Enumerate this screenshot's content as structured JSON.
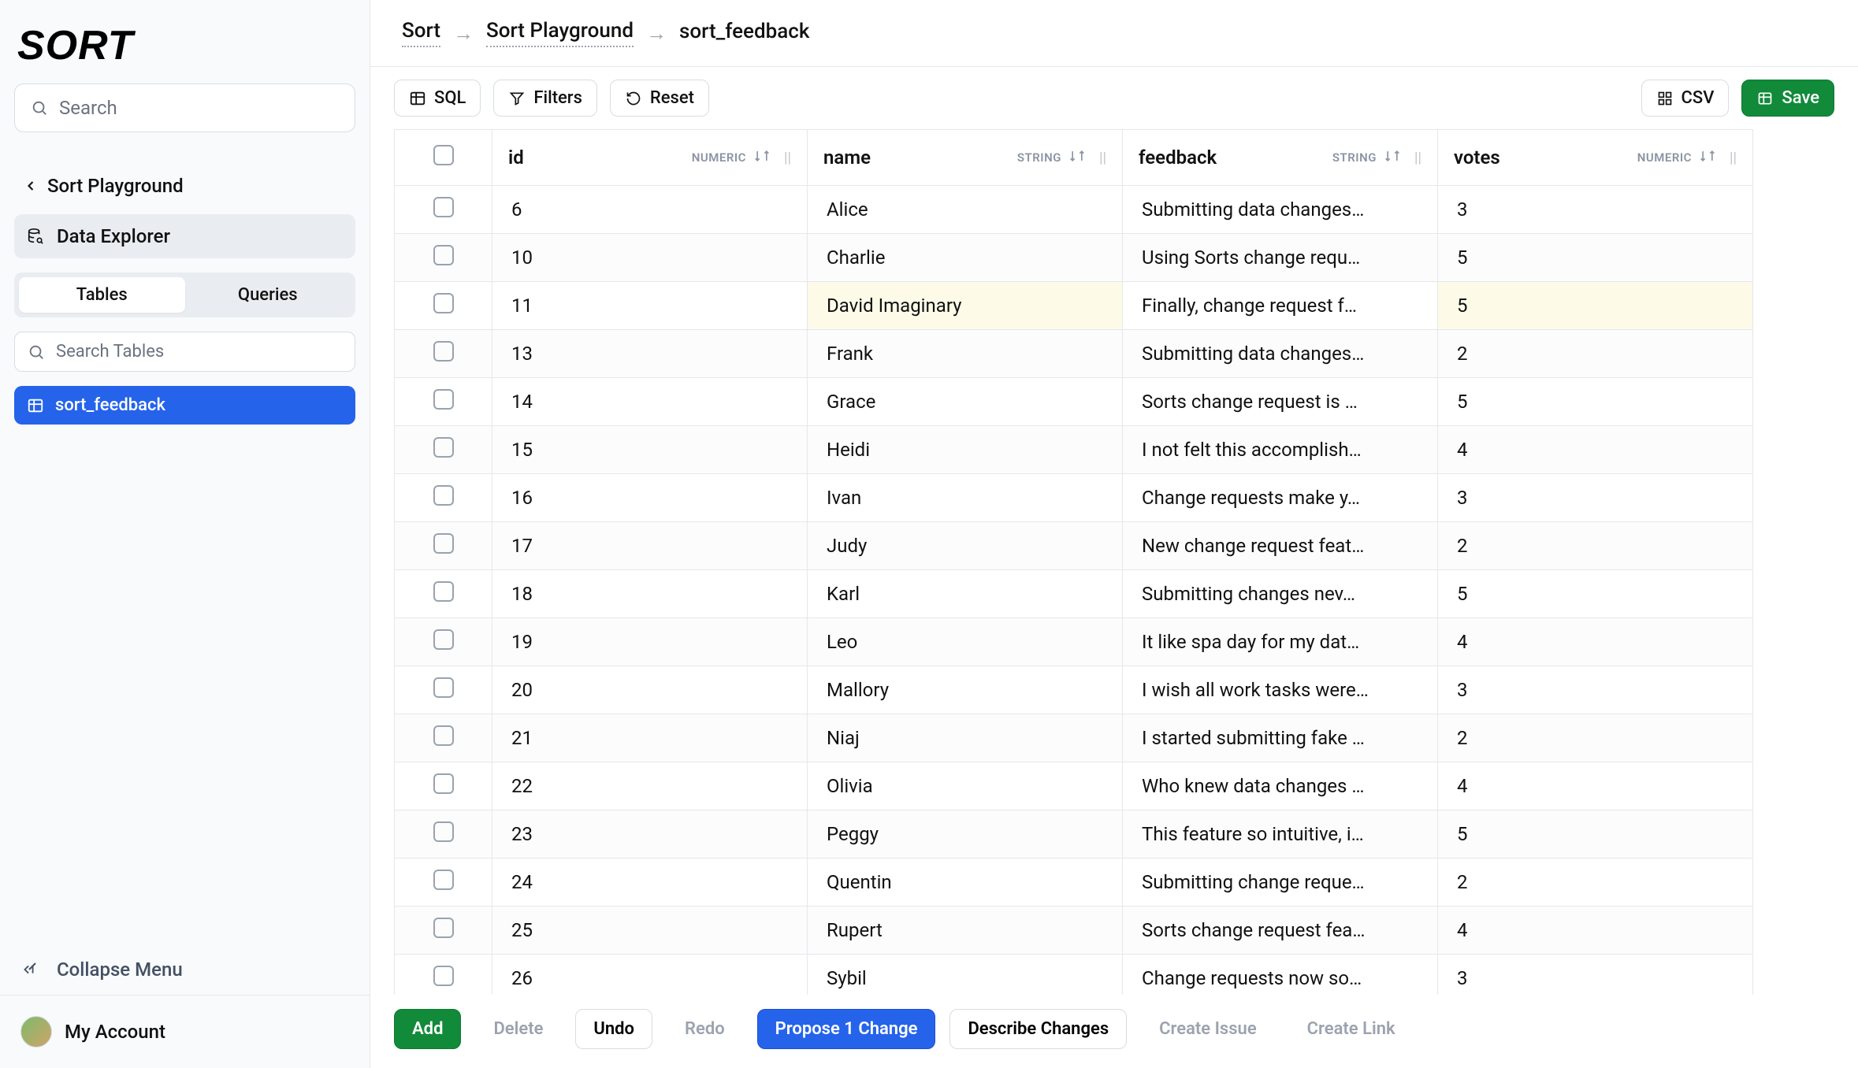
{
  "logo_text": "SORT",
  "sidebar": {
    "search_placeholder": "Search",
    "back_label": "Sort Playground",
    "data_explorer_label": "Data Explorer",
    "tabs": {
      "tables": "Tables",
      "queries": "Queries"
    },
    "search_tables_placeholder": "Search Tables",
    "active_table": "sort_feedback",
    "collapse_label": "Collapse Menu",
    "account_label": "My Account"
  },
  "breadcrumbs": {
    "a": "Sort",
    "b": "Sort Playground",
    "c": "sort_feedback"
  },
  "toolbar": {
    "sql": "SQL",
    "filters": "Filters",
    "reset": "Reset",
    "csv": "CSV",
    "save": "Save"
  },
  "columns": {
    "id": {
      "label": "id",
      "type": "NUMERIC"
    },
    "name": {
      "label": "name",
      "type": "STRING"
    },
    "fb": {
      "label": "feedback",
      "type": "STRING"
    },
    "votes": {
      "label": "votes",
      "type": "NUMERIC"
    }
  },
  "rows": [
    {
      "id": "6",
      "name": "Alice",
      "feedback": "Submitting data changes…",
      "votes": "3",
      "highlight": false
    },
    {
      "id": "10",
      "name": "Charlie",
      "feedback": "Using Sorts change requ…",
      "votes": "5",
      "highlight": false
    },
    {
      "id": "11",
      "name": "David Imaginary",
      "feedback": "Finally, change request f…",
      "votes": "5",
      "highlight": true
    },
    {
      "id": "13",
      "name": "Frank",
      "feedback": "Submitting data changes…",
      "votes": "2",
      "highlight": false
    },
    {
      "id": "14",
      "name": "Grace",
      "feedback": "Sorts change request is …",
      "votes": "5",
      "highlight": false
    },
    {
      "id": "15",
      "name": "Heidi",
      "feedback": "I not felt this accomplish…",
      "votes": "4",
      "highlight": false
    },
    {
      "id": "16",
      "name": "Ivan",
      "feedback": "Change requests make y…",
      "votes": "3",
      "highlight": false
    },
    {
      "id": "17",
      "name": "Judy",
      "feedback": "New change request feat…",
      "votes": "2",
      "highlight": false
    },
    {
      "id": "18",
      "name": "Karl",
      "feedback": "Submitting changes nev…",
      "votes": "5",
      "highlight": false
    },
    {
      "id": "19",
      "name": "Leo",
      "feedback": "It like spa day for my dat…",
      "votes": "4",
      "highlight": false
    },
    {
      "id": "20",
      "name": "Mallory",
      "feedback": "I wish all work tasks were…",
      "votes": "3",
      "highlight": false
    },
    {
      "id": "21",
      "name": "Niaj",
      "feedback": "I started submitting fake …",
      "votes": "2",
      "highlight": false
    },
    {
      "id": "22",
      "name": "Olivia",
      "feedback": "Who knew data changes …",
      "votes": "4",
      "highlight": false
    },
    {
      "id": "23",
      "name": "Peggy",
      "feedback": "This feature so intuitive, i…",
      "votes": "5",
      "highlight": false
    },
    {
      "id": "24",
      "name": "Quentin",
      "feedback": "Submitting change reque…",
      "votes": "2",
      "highlight": false
    },
    {
      "id": "25",
      "name": "Rupert",
      "feedback": "Sorts change request fea…",
      "votes": "4",
      "highlight": false
    },
    {
      "id": "26",
      "name": "Sybil",
      "feedback": "Change requests now so…",
      "votes": "3",
      "highlight": false
    }
  ],
  "footer": {
    "add": "Add",
    "delete": "Delete",
    "undo": "Undo",
    "redo": "Redo",
    "propose": "Propose 1 Change",
    "describe": "Describe Changes",
    "create_issue": "Create Issue",
    "create_link": "Create Link"
  }
}
